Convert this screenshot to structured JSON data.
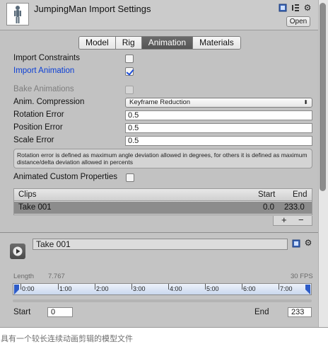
{
  "header": {
    "title": "JumpingMan Import Settings",
    "open_label": "Open",
    "icons": [
      "book-icon",
      "preset-icon",
      "gear-icon"
    ]
  },
  "tabs": [
    {
      "label": "Model",
      "active": false
    },
    {
      "label": "Rig",
      "active": false
    },
    {
      "label": "Animation",
      "active": true
    },
    {
      "label": "Materials",
      "active": false
    }
  ],
  "settings": {
    "import_constraints": {
      "label": "Import Constraints",
      "checked": false
    },
    "import_animation": {
      "label": "Import Animation",
      "checked": true
    },
    "bake_animations": {
      "label": "Bake Animations",
      "checked": false,
      "disabled": true
    },
    "anim_compression": {
      "label": "Anim. Compression",
      "value": "Keyframe Reduction",
      "arrow": "⬍"
    },
    "rotation_error": {
      "label": "Rotation Error",
      "value": "0.5"
    },
    "position_error": {
      "label": "Position Error",
      "value": "0.5"
    },
    "scale_error": {
      "label": "Scale Error",
      "value": "0.5"
    },
    "help_text": "Rotation error is defined as maximum angle deviation allowed in degrees, for others it is defined as maximum distance/delta deviation allowed in percents",
    "animated_custom_properties": {
      "label": "Animated Custom Properties",
      "checked": false
    }
  },
  "clips": {
    "headers": {
      "name": "Clips",
      "start": "Start",
      "end": "End"
    },
    "rows": [
      {
        "name": "Take 001",
        "start": "0.0",
        "end": "233.0"
      }
    ],
    "add_label": "+",
    "remove_label": "−"
  },
  "clip_editor": {
    "name": "Take 001",
    "length_label": "Length",
    "length_value": "7.767",
    "fps": "30 FPS",
    "timeline_labels": [
      "0:00",
      "1:00",
      "2:00",
      "3:00",
      "4:00",
      "5:00",
      "6:00",
      "7:00"
    ],
    "start_label": "Start",
    "start_value": "0",
    "end_label": "End",
    "end_value": "233"
  },
  "caption": "具有一个较长连续动画剪辑的模型文件",
  "colors": {
    "accent_blue": "#0b3fd6",
    "active_tab": "#555555",
    "selected_row": "#8c8c8c",
    "timeline": "#c9d7ee"
  }
}
